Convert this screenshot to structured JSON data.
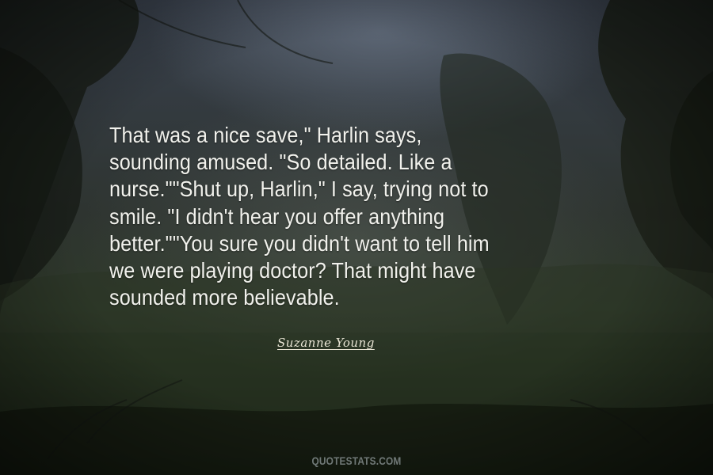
{
  "quote": {
    "lines": [
      "That was a nice save,\" Harlin says,",
      "sounding amused. \"So detailed. Like a",
      "nurse.\"\"Shut up, Harlin,\" I say, trying not to",
      "smile. \"I didn't hear you offer anything",
      "better.\"\"You sure you didn't want to tell him",
      "we were playing doctor? That might have",
      "sounded more believable."
    ]
  },
  "author": {
    "name": "Suzanne Young"
  },
  "watermark": {
    "text": "QUOTESTATS.COM"
  },
  "colors": {
    "text": "#f1f1ec",
    "background": "#2e3430"
  }
}
